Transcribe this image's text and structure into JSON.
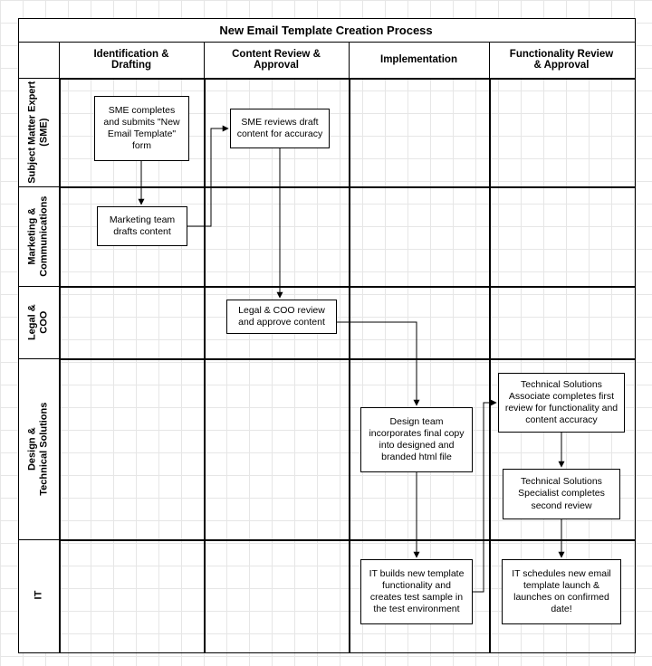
{
  "title": "New Email Template Creation Process",
  "columns": {
    "c1": "Identification &\nDrafting",
    "c2": "Content Review &\nApproval",
    "c3": "Implementation",
    "c4": "Functionality Review\n& Approval"
  },
  "rows": {
    "r1": "Subject Matter Expert\n(SME)",
    "r2": "Marketing &\nCommunications",
    "r3": "Legal &\nCOO",
    "r4": "Design &\nTechnical Solutions",
    "r5": "IT"
  },
  "boxes": {
    "b1": "SME completes and submits \"New Email Template\" form",
    "b2": "Marketing team drafts content",
    "b3": "SME reviews draft content for accuracy",
    "b4": "Legal & COO review and approve content",
    "b5": "Design team incorporates final copy into designed and branded html file",
    "b6": "IT builds new template functionality and creates test sample in the test environment",
    "b7": "Technical Solutions Associate completes first review for functionality and content accuracy",
    "b8": "Technical Solutions Specialist completes second review",
    "b9": "IT schedules new email template launch & launches on confirmed date!"
  },
  "chart_data": {
    "type": "swimlane-flowchart",
    "title": "New Email Template Creation Process",
    "phases": [
      "Identification & Drafting",
      "Content Review & Approval",
      "Implementation",
      "Functionality Review & Approval"
    ],
    "lanes": [
      "Subject Matter Expert (SME)",
      "Marketing & Communications",
      "Legal & COO",
      "Design & Technical Solutions",
      "IT"
    ],
    "nodes": [
      {
        "id": "b1",
        "lane": "Subject Matter Expert (SME)",
        "phase": "Identification & Drafting",
        "label": "SME completes and submits \"New Email Template\" form"
      },
      {
        "id": "b2",
        "lane": "Marketing & Communications",
        "phase": "Identification & Drafting",
        "label": "Marketing team drafts content"
      },
      {
        "id": "b3",
        "lane": "Subject Matter Expert (SME)",
        "phase": "Content Review & Approval",
        "label": "SME reviews draft content for accuracy"
      },
      {
        "id": "b4",
        "lane": "Legal & COO",
        "phase": "Content Review & Approval",
        "label": "Legal & COO review and approve content"
      },
      {
        "id": "b5",
        "lane": "Design & Technical Solutions",
        "phase": "Implementation",
        "label": "Design team incorporates final copy into designed and branded html file"
      },
      {
        "id": "b6",
        "lane": "IT",
        "phase": "Implementation",
        "label": "IT builds new template functionality and creates test sample in the test environment"
      },
      {
        "id": "b7",
        "lane": "Design & Technical Solutions",
        "phase": "Functionality Review & Approval",
        "label": "Technical Solutions Associate completes first review for functionality and content accuracy"
      },
      {
        "id": "b8",
        "lane": "Design & Technical Solutions",
        "phase": "Functionality Review & Approval",
        "label": "Technical Solutions Specialist completes second review"
      },
      {
        "id": "b9",
        "lane": "IT",
        "phase": "Functionality Review & Approval",
        "label": "IT schedules new email template launch & launches on confirmed date!"
      }
    ],
    "edges": [
      {
        "from": "b1",
        "to": "b2"
      },
      {
        "from": "b2",
        "to": "b3"
      },
      {
        "from": "b3",
        "to": "b4"
      },
      {
        "from": "b4",
        "to": "b5"
      },
      {
        "from": "b5",
        "to": "b6"
      },
      {
        "from": "b6",
        "to": "b7"
      },
      {
        "from": "b7",
        "to": "b8"
      },
      {
        "from": "b8",
        "to": "b9"
      }
    ]
  }
}
